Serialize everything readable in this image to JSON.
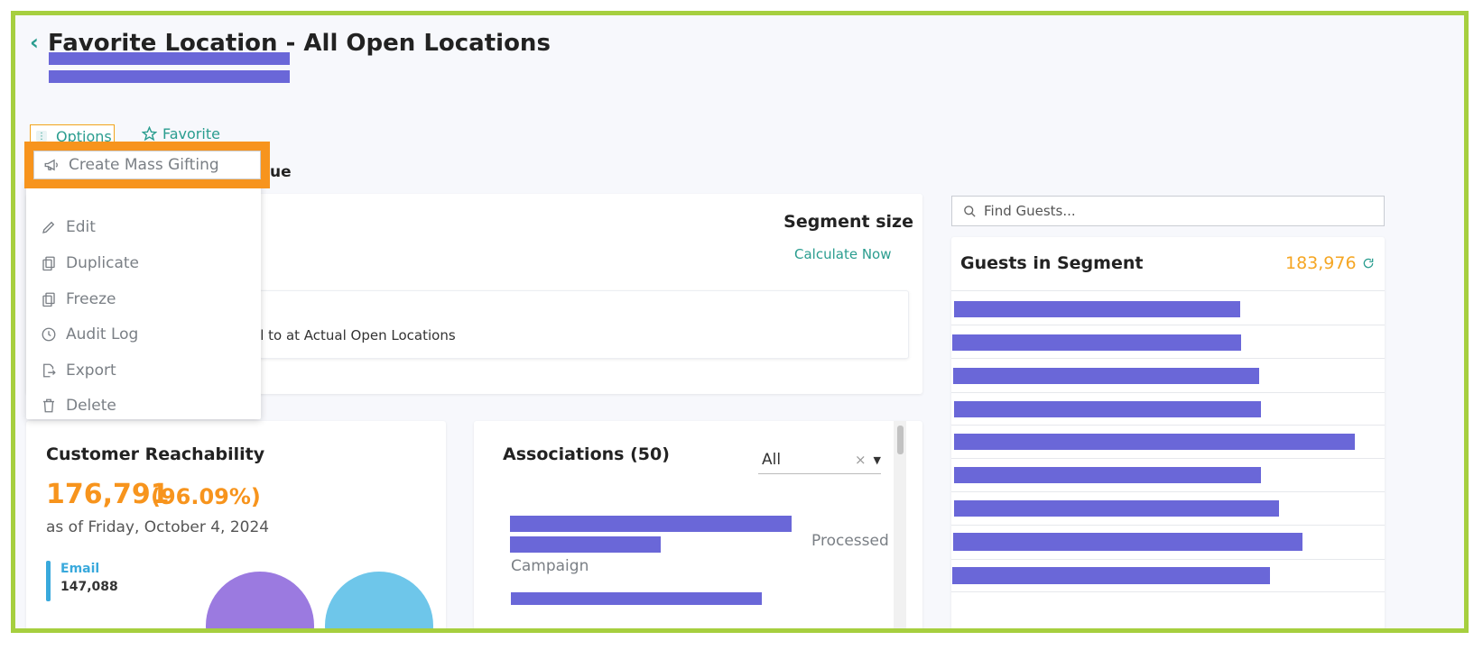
{
  "header": {
    "title": "Favorite Location - All Open Locations"
  },
  "actions": {
    "options_label": "Options",
    "favorite_label": "Favorite"
  },
  "menu": {
    "highlighted": "Create Mass Gifting",
    "items": [
      {
        "label": "Edit",
        "icon": "pencil-icon"
      },
      {
        "label": "Duplicate",
        "icon": "copy-icon"
      },
      {
        "label": "Freeze",
        "icon": "copy-icon"
      },
      {
        "label": "Audit Log",
        "icon": "clock-icon"
      },
      {
        "label": "Export",
        "icon": "export-icon"
      },
      {
        "label": "Delete",
        "icon": "trash-icon"
      }
    ]
  },
  "segment": {
    "hidden_heading_fragment": "ue",
    "size_label": "Segment size",
    "calculate_label": "Calculate Now",
    "condition_fragment": "al to at Actual Open Locations"
  },
  "guests": {
    "search_placeholder": "Find Guests...",
    "title": "Guests in Segment",
    "count": "183,976"
  },
  "reachability": {
    "title": "Customer Reachability",
    "count": "176,791",
    "percent": "(96.09%)",
    "date": "as of Friday, October 4, 2024",
    "email_label": "Email",
    "email_value": "147,088"
  },
  "associations": {
    "title": "Associations (50)",
    "filter_value": "All",
    "status": "Processed",
    "type": "Campaign"
  },
  "colors": {
    "accent": "#2a9d8f",
    "orange": "#f7941d",
    "frame": "#a6cf3f",
    "redact": "#6a67d8"
  }
}
